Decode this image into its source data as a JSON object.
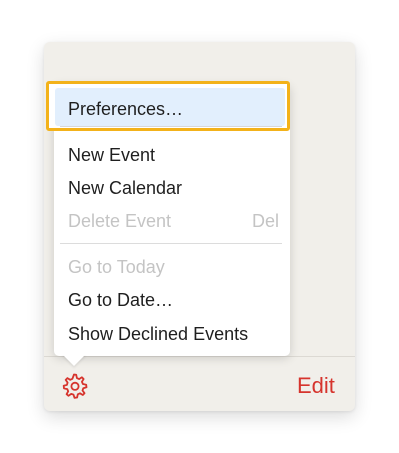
{
  "menu": {
    "items": [
      {
        "label": "Preferences…",
        "enabled": true,
        "highlighted": true
      },
      {
        "label": "New Event",
        "enabled": true
      },
      {
        "label": "New Calendar",
        "enabled": true
      },
      {
        "label": "Delete Event",
        "enabled": false,
        "shortcut": "Del"
      },
      {
        "label": "Go to Today",
        "enabled": false
      },
      {
        "label": "Go to Date…",
        "enabled": true
      },
      {
        "label": "Show Declined Events",
        "enabled": true
      }
    ]
  },
  "footer": {
    "edit_label": "Edit",
    "settings_icon": "gear-icon"
  },
  "colors": {
    "accent_red": "#d6342d",
    "highlight_border": "#f3b21a",
    "highlight_fill": "#e2effd",
    "panel_bg": "#f1efea"
  }
}
